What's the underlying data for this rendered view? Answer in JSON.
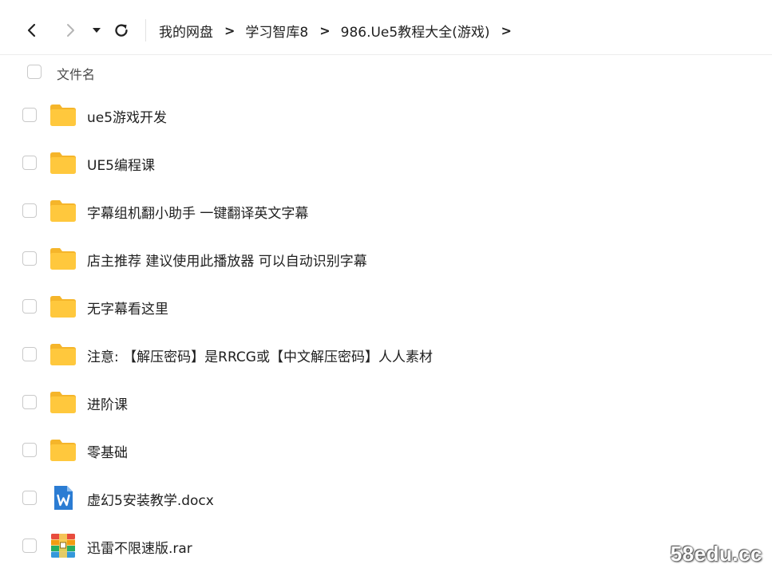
{
  "toolbar": {
    "back_icon": "chevron-left-icon",
    "forward_icon": "chevron-right-icon",
    "history_icon": "caret-down-icon",
    "refresh_icon": "refresh-icon",
    "breadcrumb": [
      "我的网盘",
      "学习智库8",
      "986.Ue5教程大全(游戏)"
    ],
    "separator": ">"
  },
  "list_header": {
    "name_column": "文件名"
  },
  "files": [
    {
      "name": "ue5游戏开发",
      "type": "folder"
    },
    {
      "name": "UE5编程课",
      "type": "folder"
    },
    {
      "name": "字幕组机翻小助手 一键翻译英文字幕",
      "type": "folder"
    },
    {
      "name": "店主推荐 建议使用此播放器 可以自动识别字幕",
      "type": "folder"
    },
    {
      "name": "无字幕看这里",
      "type": "folder"
    },
    {
      "name": "注意: 【解压密码】是RRCG或【中文解压密码】人人素材",
      "type": "folder"
    },
    {
      "name": "进阶课",
      "type": "folder"
    },
    {
      "name": "零基础",
      "type": "folder"
    },
    {
      "name": "虚幻5安装教学.docx",
      "type": "docx"
    },
    {
      "name": "迅雷不限速版.rar",
      "type": "rar"
    }
  ],
  "colors": {
    "folder": "#FFC83D",
    "folder_tab": "#F5B52A",
    "docx": "#2B7CD3",
    "rar": "#E84C3D"
  },
  "watermark": "58edu.cc"
}
